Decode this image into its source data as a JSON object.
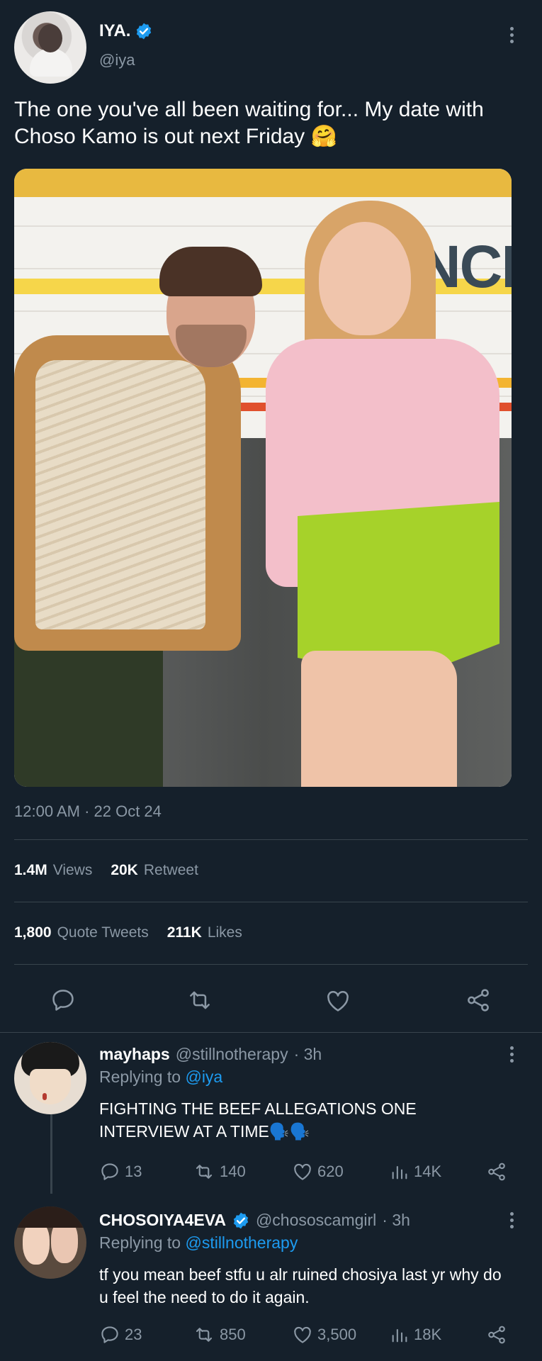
{
  "tweet": {
    "author_name": "IYA.",
    "author_handle": "@iya",
    "text": "The one you've all been waiting for... My date with Choso Kamo is out next Friday 🤗",
    "timestamp": "12:00 AM · 22 Oct 24",
    "views_count": "1.4M",
    "views_label": "Views",
    "retweet_count": "20K",
    "retweet_label": "Retweet",
    "quote_count": "1,800",
    "quote_label": "Quote Tweets",
    "likes_count": "211K",
    "likes_label": "Likes",
    "photo_sign_text": "NCE"
  },
  "replies": [
    {
      "name": "mayhaps",
      "handle": "@stillnotherapy",
      "time": "· 3h",
      "replying_label": "Replying to",
      "replying_to": "@iya",
      "text": "FIGHTING THE BEEF ALLEGATIONS ONE INTERVIEW AT A TIME🗣️🗣️",
      "comments": "13",
      "retweets": "140",
      "likes": "620",
      "views": "14K"
    },
    {
      "name": "CHOSOIYA4EVA",
      "handle": "@chososcamgirl",
      "time": "· 3h",
      "replying_label": "Replying to",
      "replying_to": "@stillnotherapy",
      "text": "tf you mean beef stfu u alr ruined chosiya last yr why do u feel the need to do it again.",
      "comments": "23",
      "retweets": "850",
      "likes": "3,500",
      "views": "18K"
    }
  ],
  "colors": {
    "background": "#15202b",
    "muted": "#8b98a5",
    "link": "#1d9bf0",
    "verified": "#1d9bf0",
    "divider": "#38444d"
  },
  "icons": [
    "verified-badge-icon",
    "more-icon",
    "comment-icon",
    "retweet-icon",
    "heart-icon",
    "share-icon",
    "views-icon"
  ]
}
